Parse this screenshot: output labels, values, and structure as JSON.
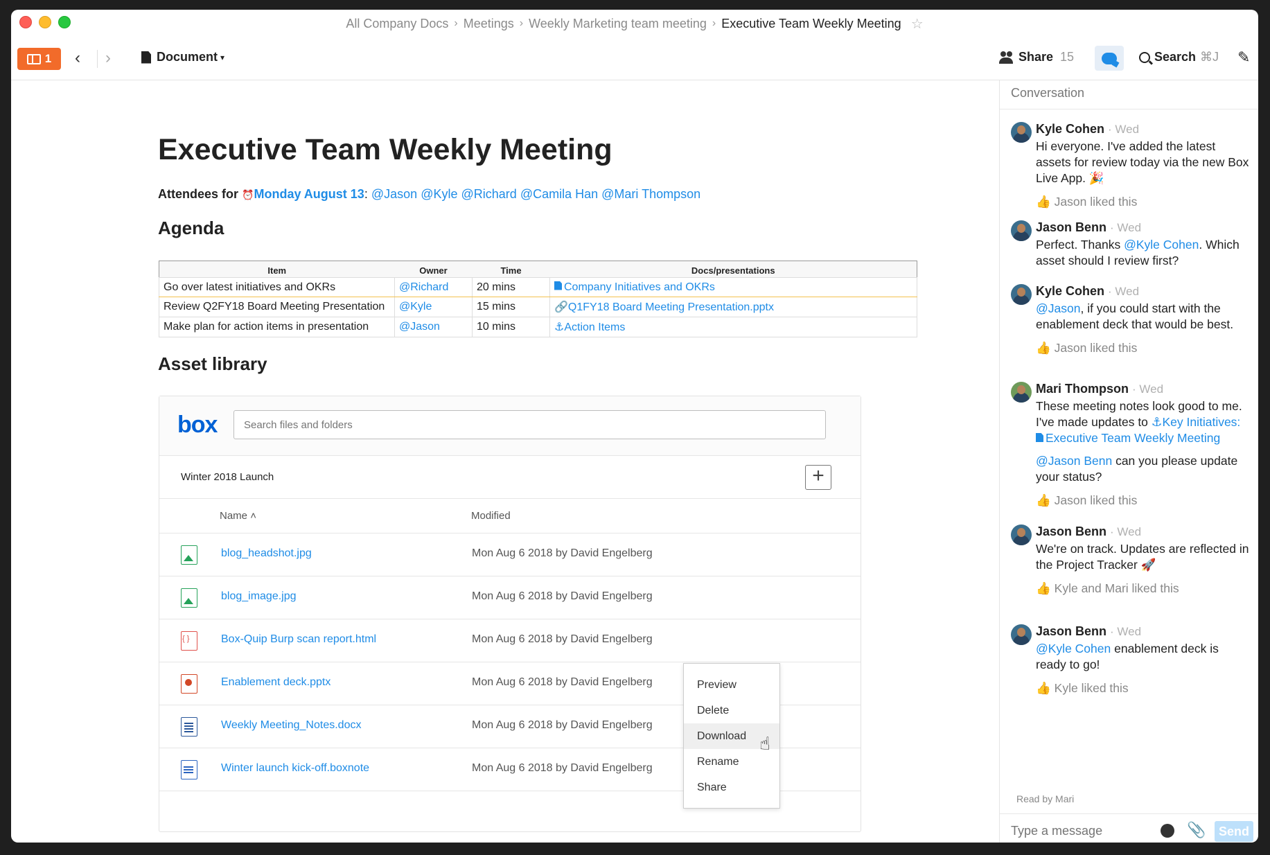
{
  "breadcrumb": {
    "items": [
      "All Company Docs",
      "Meetings",
      "Weekly Marketing team meeting"
    ],
    "current": "Executive Team Weekly Meeting",
    "sep": "›"
  },
  "toolbar": {
    "inbox_count": "1",
    "doc_menu": "Document",
    "share_label": "Share",
    "share_count": "15",
    "search_label": "Search",
    "search_shortcut": "⌘J"
  },
  "doc": {
    "title": "Executive Team Weekly Meeting",
    "attendees_prefix": "Attendees for",
    "date": "Monday August 13",
    "colon": ":",
    "attendees": [
      "@Jason",
      "@Kyle",
      "@Richard",
      "@Camila Han",
      "@Mari Thompson"
    ],
    "agenda_heading": "Agenda",
    "agenda": {
      "headers": [
        "Item",
        "Owner",
        "Time",
        "Docs/presentations"
      ],
      "rows": [
        {
          "item": "Go over latest initiatives and OKRs",
          "owner": "@Richard",
          "time": "20 mins",
          "doc": "Company Initiatives and OKRs",
          "icon": "document-icon"
        },
        {
          "item": "Review Q2FY18 Board Meeting Presentation",
          "owner": "@Kyle",
          "time": "15 mins",
          "doc": "Q1FY18 Board Meeting Presentation.pptx",
          "icon": "attachment-icon"
        },
        {
          "item": "Make plan for action items in presentation",
          "owner": "@Jason",
          "time": "10 mins",
          "doc": "Action Items",
          "icon": "anchor-icon"
        }
      ]
    },
    "asset_heading": "Asset library"
  },
  "box": {
    "logo": "box",
    "search_placeholder": "Search files and folders",
    "folder": "Winter 2018 Launch",
    "col_name": "Name",
    "col_modified": "Modified",
    "files": [
      {
        "name": "blog_headshot.jpg",
        "modified": "Mon Aug 6 2018 by David Engelberg",
        "type": "img"
      },
      {
        "name": "blog_image.jpg",
        "modified": "Mon Aug 6 2018 by David Engelberg",
        "type": "img"
      },
      {
        "name": "Box-Quip Burp scan report.html",
        "modified": "Mon Aug 6 2018 by David Engelberg",
        "type": "code"
      },
      {
        "name": "Enablement deck.pptx",
        "modified": "Mon Aug 6 2018 by David Engelberg",
        "type": "ppt"
      },
      {
        "name": "Weekly Meeting_Notes.docx",
        "modified": "Mon Aug 6 2018 by David Engelberg",
        "type": "doc"
      },
      {
        "name": "Winter launch kick-off.boxnote",
        "modified": "Mon Aug 6 2018 by David Engelberg",
        "type": "note"
      }
    ],
    "context_menu": [
      "Preview",
      "Delete",
      "Download",
      "Rename",
      "Share"
    ]
  },
  "conversation": {
    "title": "Conversation",
    "messages": [
      {
        "author": "Kyle Cohen",
        "time": "· Wed",
        "text": "Hi everyone. I've added the latest assets for review today via the new Box Live App. 🎉",
        "like": "Jason liked this"
      },
      {
        "author": "Jason Benn",
        "time": "· Wed",
        "text_pre": "Perfect. Thanks ",
        "mention": "@Kyle Cohen",
        "text_post": ". Which asset should I review first?"
      },
      {
        "author": "Kyle Cohen",
        "time": "· Wed",
        "mention": "@Jason",
        "text_post": ", if you could start with the enablement deck that would be best.",
        "like": "Jason liked this"
      },
      {
        "author": "Mari Thompson",
        "time": "· Wed",
        "text_pre": "These meeting notes look good to me. I've made updates to ",
        "link1": "⚓Key Initiatives: ",
        "link2": "Executive Team Weekly Meeting",
        "mention2": "@Jason Benn",
        "text2": " can you please update your status?",
        "like": "Jason liked this"
      },
      {
        "author": "Jason Benn",
        "time": "· Wed",
        "text": "We're on track. Updates are reflected in the Project Tracker 🚀",
        "like": "Kyle and Mari liked this"
      },
      {
        "author": "Jason Benn",
        "time": "· Wed",
        "mention": "@Kyle Cohen",
        "text_post": " enablement deck is ready to go!",
        "like": "Kyle liked this"
      }
    ],
    "read_by": "Read by Mari",
    "composer_placeholder": "Type a message",
    "send_label": "Send"
  }
}
